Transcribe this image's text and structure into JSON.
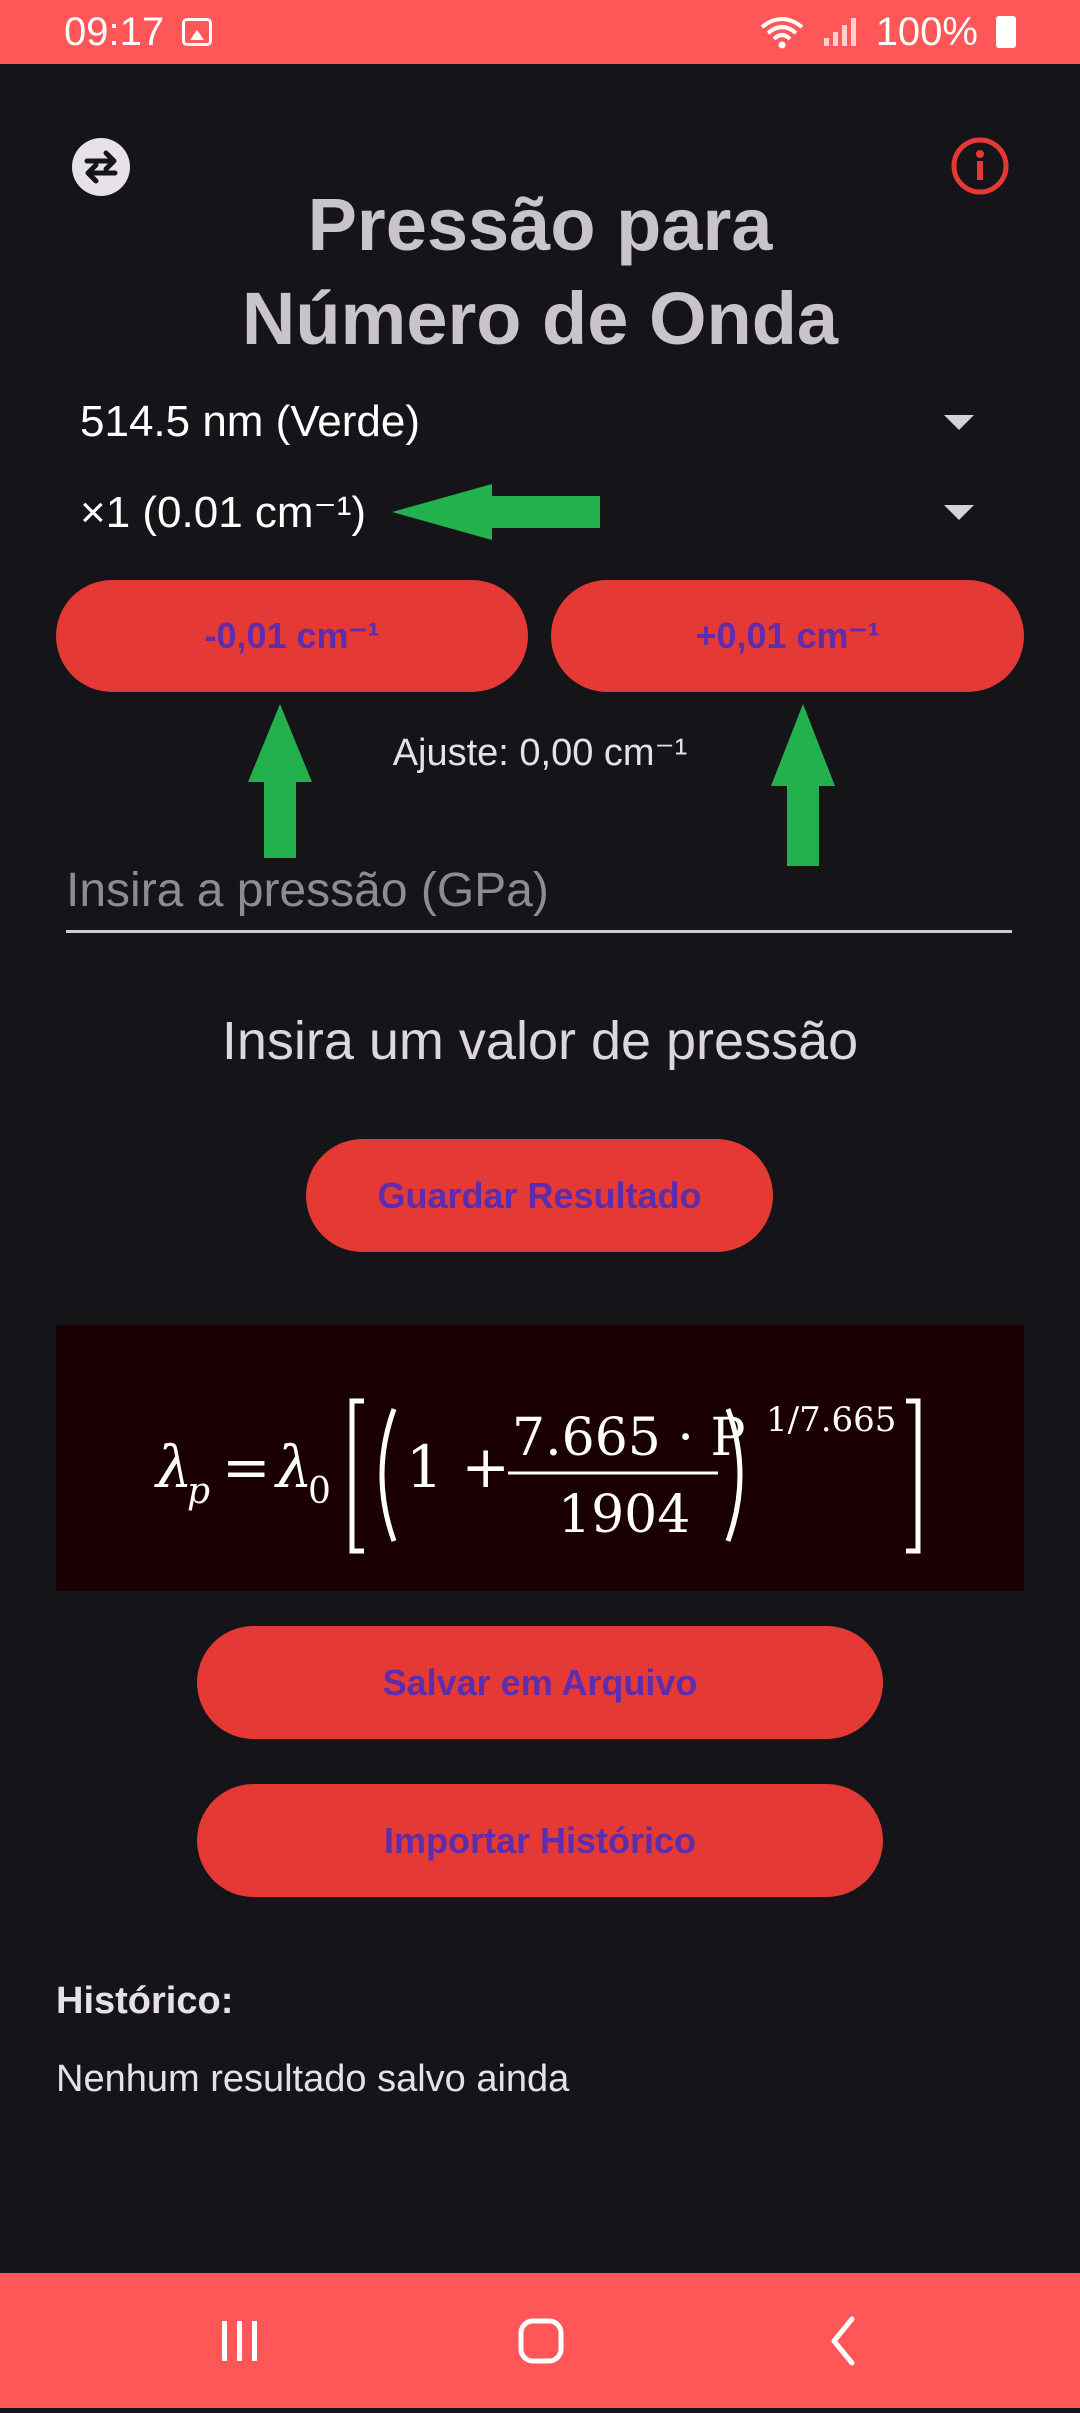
{
  "status_bar": {
    "time": "09:17",
    "battery": "100%"
  },
  "header": {
    "title_line1": "Pressão para",
    "title_line2": "Número de Onda"
  },
  "laser_select": {
    "value": "514.5 nm (Verde)"
  },
  "step_select": {
    "value": "×1 (0.01 cm⁻¹)"
  },
  "buttons": {
    "decrement": "-0,01 cm⁻¹",
    "increment": "+0,01 cm⁻¹",
    "save_result": "Guardar Resultado",
    "save_file": "Salvar em Arquivo",
    "import_history": "Importar Histórico"
  },
  "adjust_text": "Ajuste: 0,00 cm⁻¹",
  "pressure_input": {
    "placeholder": "Insira a pressão (GPa)"
  },
  "prompt_text": "Insira um valor de pressão",
  "formula": {
    "lhs": "λ",
    "lhs_sub": "p",
    "rhs": "λ",
    "rhs_sub": "0",
    "one_plus": "1 +",
    "numerator": "7.665 · P",
    "denominator": "1904",
    "exponent": "1/7.665"
  },
  "history": {
    "label": "Histórico:",
    "empty": "Nenhum resultado salvo ainda"
  },
  "colors": {
    "accent": "#e53935",
    "button_text": "#5e2dae",
    "status_bar": "#ff5757",
    "background": "#151418",
    "annotation_arrow": "#22b14c",
    "formula_bg": "#1b0003"
  },
  "icons": [
    "swap-icon",
    "info-icon",
    "gallery-icon",
    "wifi-icon",
    "signal-icon",
    "battery-icon",
    "recent-apps-icon",
    "home-icon",
    "back-icon"
  ]
}
